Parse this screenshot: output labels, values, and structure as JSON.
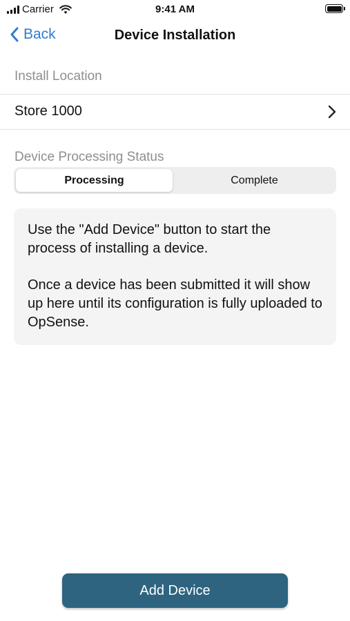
{
  "status_bar": {
    "carrier": "Carrier",
    "time": "9:41 AM"
  },
  "nav": {
    "back_label": "Back",
    "title": "Device Installation"
  },
  "install_location": {
    "header": "Install Location",
    "value": "Store 1000"
  },
  "processing": {
    "header": "Device Processing Status",
    "segments": [
      {
        "label": "Processing",
        "selected": true
      },
      {
        "label": "Complete",
        "selected": false
      }
    ]
  },
  "info": {
    "paragraph_1": "Use the \"Add Device\" button to start the process of installing a device.",
    "paragraph_2": "Once a device has been submitted it will show up here until its configuration is fully uploaded to OpSense."
  },
  "actions": {
    "add_device_label": "Add Device"
  },
  "colors": {
    "accent": "#2f7ccf",
    "primary_button": "#2e6480",
    "secondary_text": "#8e8e93"
  }
}
